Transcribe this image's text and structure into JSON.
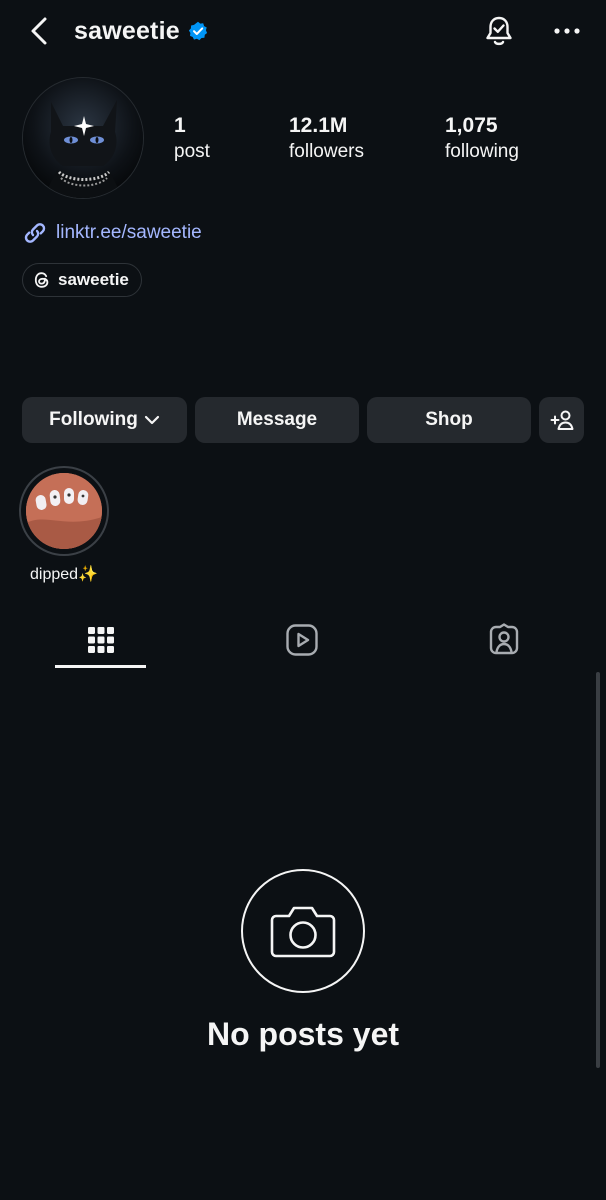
{
  "header": {
    "username": "saweetie",
    "back_icon": "chevron-left-icon",
    "verified_icon": "verified-badge-icon",
    "notifications_icon": "bell-check-icon",
    "more_icon": "more-horizontal-icon"
  },
  "profile": {
    "avatar_icon": "profile-avatar",
    "stats": {
      "posts": {
        "value": "1",
        "label": "post"
      },
      "followers": {
        "value": "12.1M",
        "label": "followers"
      },
      "following": {
        "value": "1,075",
        "label": "following"
      }
    },
    "link": {
      "text": "linktr.ee/saweetie",
      "icon": "link-icon"
    },
    "threads": {
      "handle": "saweetie",
      "icon": "threads-icon"
    }
  },
  "actions": {
    "following_label": "Following",
    "message_label": "Message",
    "shop_label": "Shop",
    "add_user_icon": "add-user-icon"
  },
  "highlights": [
    {
      "label": "dipped✨"
    }
  ],
  "tabs": [
    {
      "icon": "grid-icon",
      "selected": true
    },
    {
      "icon": "reels-icon",
      "selected": false
    },
    {
      "icon": "tagged-icon",
      "selected": false
    }
  ],
  "empty_state": {
    "icon": "camera-icon",
    "title": "No posts yet"
  },
  "colors": {
    "background": "#0c1014",
    "button": "#25292e",
    "link": "#a4b7ff",
    "verified": "#0095f6",
    "text": "#f5f5f5"
  }
}
